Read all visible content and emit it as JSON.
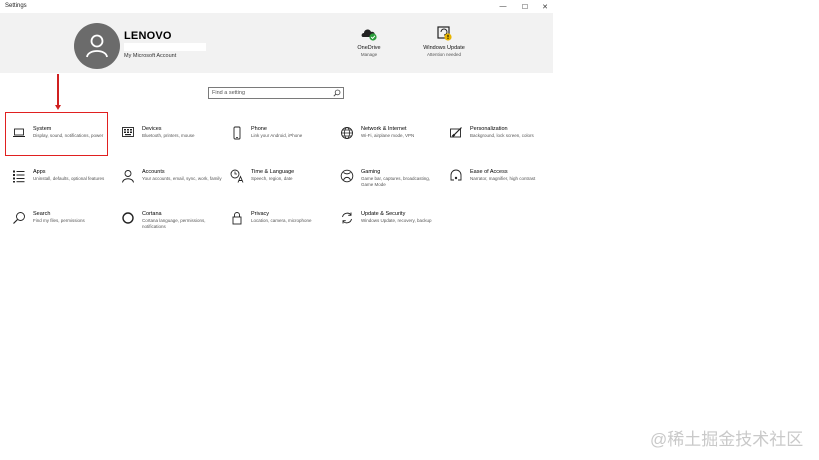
{
  "window": {
    "title": "Settings"
  },
  "controls": {
    "minimize": "—",
    "maximize": "☐",
    "close": "✕"
  },
  "account": {
    "name": "LENOVO",
    "link": "My Microsoft Account"
  },
  "header_items": [
    {
      "title": "OneDrive",
      "subtitle": "Manage",
      "icon": "onedrive-icon"
    },
    {
      "title": "Windows Update",
      "subtitle": "Attention needed",
      "icon": "windows-update-icon"
    }
  ],
  "search": {
    "placeholder": "Find a setting"
  },
  "tiles": [
    {
      "name": "System",
      "desc": "Display, sound, notifications, power",
      "icon": "laptop-icon"
    },
    {
      "name": "Devices",
      "desc": "Bluetooth, printers, mouse",
      "icon": "keyboard-icon"
    },
    {
      "name": "Phone",
      "desc": "Link your Android, iPhone",
      "icon": "phone-icon"
    },
    {
      "name": "Network & Internet",
      "desc": "Wi-Fi, airplane mode, VPN",
      "icon": "globe-icon"
    },
    {
      "name": "Personalization",
      "desc": "Background, lock screen, colors",
      "icon": "paint-brush-icon"
    },
    {
      "name": "Apps",
      "desc": "Uninstall, defaults, optional features",
      "icon": "apps-list-icon"
    },
    {
      "name": "Accounts",
      "desc": "Your accounts, email, sync, work, family",
      "icon": "person-icon"
    },
    {
      "name": "Time & Language",
      "desc": "Speech, region, date",
      "icon": "time-language-icon"
    },
    {
      "name": "Gaming",
      "desc": "Game bar, captures, broadcasting, Game Mode",
      "icon": "xbox-icon"
    },
    {
      "name": "Ease of Access",
      "desc": "Narrator, magnifier, high contrast",
      "icon": "ease-of-access-icon"
    },
    {
      "name": "Search",
      "desc": "Find my files, permissions",
      "icon": "search-icon"
    },
    {
      "name": "Cortana",
      "desc": "Cortana language, permissions, notifications",
      "icon": "cortana-icon"
    },
    {
      "name": "Privacy",
      "desc": "Location, camera, microphone",
      "icon": "lock-icon"
    },
    {
      "name": "Update & Security",
      "desc": "Windows Update, recovery, backup",
      "icon": "sync-icon"
    }
  ],
  "annotation_color": "#e02020",
  "watermark": "@稀土掘金技术社区"
}
